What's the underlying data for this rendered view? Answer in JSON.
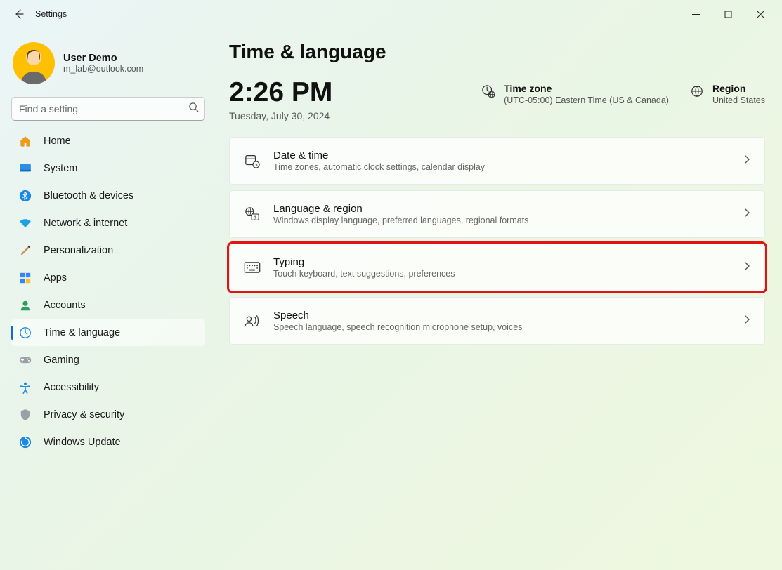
{
  "window": {
    "title": "Settings"
  },
  "profile": {
    "name": "User Demo",
    "email": "m_lab@outlook.com"
  },
  "search": {
    "placeholder": "Find a setting"
  },
  "nav": {
    "items": [
      {
        "label": "Home"
      },
      {
        "label": "System"
      },
      {
        "label": "Bluetooth & devices"
      },
      {
        "label": "Network & internet"
      },
      {
        "label": "Personalization"
      },
      {
        "label": "Apps"
      },
      {
        "label": "Accounts"
      },
      {
        "label": "Time & language"
      },
      {
        "label": "Gaming"
      },
      {
        "label": "Accessibility"
      },
      {
        "label": "Privacy & security"
      },
      {
        "label": "Windows Update"
      }
    ],
    "active_index": 7
  },
  "page": {
    "title": "Time & language",
    "clock": {
      "time": "2:26 PM",
      "date": "Tuesday, July 30, 2024"
    },
    "timezone": {
      "label": "Time zone",
      "value": "(UTC-05:00) Eastern Time (US & Canada)"
    },
    "region": {
      "label": "Region",
      "value": "United States"
    },
    "cards": [
      {
        "title": "Date & time",
        "subtitle": "Time zones, automatic clock settings, calendar display"
      },
      {
        "title": "Language & region",
        "subtitle": "Windows display language, preferred languages, regional formats"
      },
      {
        "title": "Typing",
        "subtitle": "Touch keyboard, text suggestions, preferences",
        "highlight": true
      },
      {
        "title": "Speech",
        "subtitle": "Speech language, speech recognition microphone setup, voices"
      }
    ]
  }
}
